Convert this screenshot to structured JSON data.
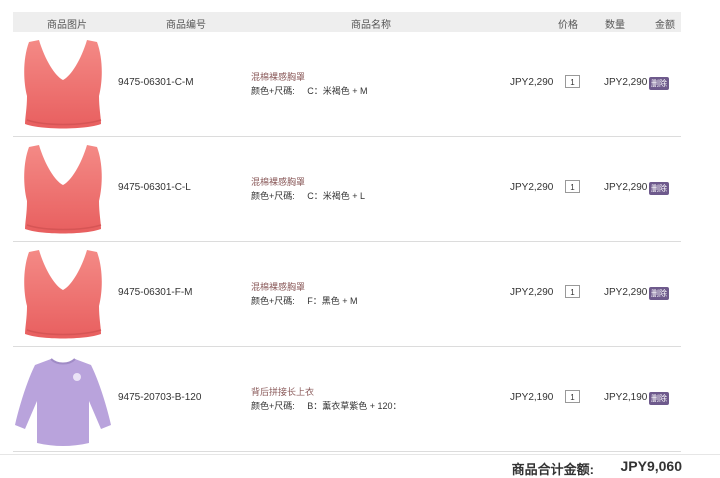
{
  "table": {
    "headers": {
      "image": "商品图片",
      "code": "商品编号",
      "name": "商品名称",
      "price": "价格",
      "qty": "数量",
      "amount": "金额"
    },
    "rows": [
      {
        "image_icon": "pink-bra-image",
        "code": "9475-06301-C-M",
        "name": "混棉裸感胸罩",
        "attr": "颜色+尺碼:     C：米褐色 + M",
        "price": "JPY2,290",
        "qty": "1",
        "amount": "JPY2,290",
        "delete": "删除"
      },
      {
        "image_icon": "pink-bra-image",
        "code": "9475-06301-C-L",
        "name": "混棉裸感胸罩",
        "attr": "颜色+尺碼:     C：米褐色 + L",
        "price": "JPY2,290",
        "qty": "1",
        "amount": "JPY2,290",
        "delete": "删除"
      },
      {
        "image_icon": "pink-bra-image",
        "code": "9475-06301-F-M",
        "name": "混棉裸感胸罩",
        "attr": "颜色+尺碼:     F：黑色 + M",
        "price": "JPY2,290",
        "qty": "1",
        "amount": "JPY2,290",
        "delete": "删除"
      },
      {
        "image_icon": "lavender-top-image",
        "code": "9475-20703-B-120",
        "name": "背后拼接长上衣",
        "attr": "颜色+尺碼:     B：薰衣草紫色 + 120：",
        "price": "JPY2,190",
        "qty": "1",
        "amount": "JPY2,190",
        "delete": "删除"
      }
    ]
  },
  "total": {
    "label": "商品合计金额:",
    "value": "JPY9,060"
  },
  "colors": {
    "bra": "#ee6e6e",
    "top": "#b9a3dc",
    "delete_button": "#6e5a8c",
    "header_bg": "#eeeeee"
  }
}
